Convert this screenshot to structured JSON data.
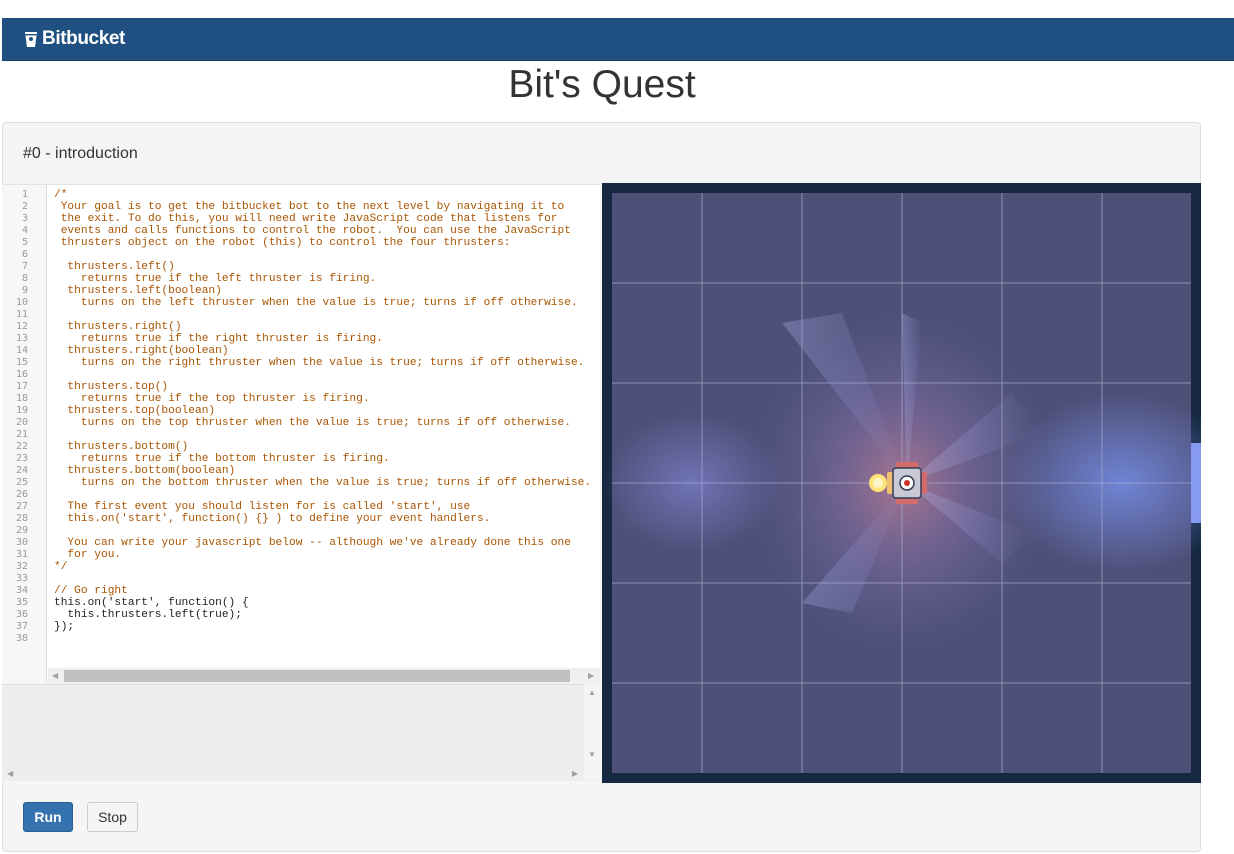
{
  "header": {
    "brand": "Bitbucket",
    "brand_icon": "bitbucket-bucket-icon"
  },
  "page": {
    "title": "Bit's Quest"
  },
  "level": {
    "title": "#0 - introduction"
  },
  "editor": {
    "lines": [
      "/*",
      " Your goal is to get the bitbucket bot to the next level by navigating it to",
      " the exit. To do this, you will need write JavaScript code that listens for",
      " events and calls functions to control the robot.  You can use the JavaScript",
      " thrusters object on the robot (this) to control the four thrusters:",
      "",
      "  thrusters.left()",
      "    returns true if the left thruster is firing.",
      "  thrusters.left(boolean)",
      "    turns on the left thruster when the value is true; turns if off otherwise.",
      "",
      "  thrusters.right()",
      "    returns true if the right thruster is firing.",
      "  thrusters.right(boolean)",
      "    turns on the right thruster when the value is true; turns if off otherwise.",
      "",
      "  thrusters.top()",
      "    returns true if the top thruster is firing.",
      "  thrusters.top(boolean)",
      "    turns on the top thruster when the value is true; turns if off otherwise.",
      "",
      "  thrusters.bottom()",
      "    returns true if the bottom thruster is firing.",
      "  thrusters.bottom(boolean)",
      "    turns on the bottom thruster when the value is true; turns if off otherwise.",
      "",
      "  The first event you should listen for is called 'start', use",
      "  this.on('start', function() {} ) to define your event handlers.",
      "",
      "  You can write your javascript below -- although we've already done this one",
      "  for you.",
      "*/",
      "",
      "// Go right",
      "this.on('start', function() {",
      "  this.thrusters.left(true);",
      "});",
      ""
    ]
  },
  "buttons": {
    "run": "Run",
    "stop": "Stop"
  },
  "game": {
    "background": "#4e5078",
    "border": "#152840",
    "grid": "#9a9dc0",
    "robot_icon": "robot-icon"
  }
}
